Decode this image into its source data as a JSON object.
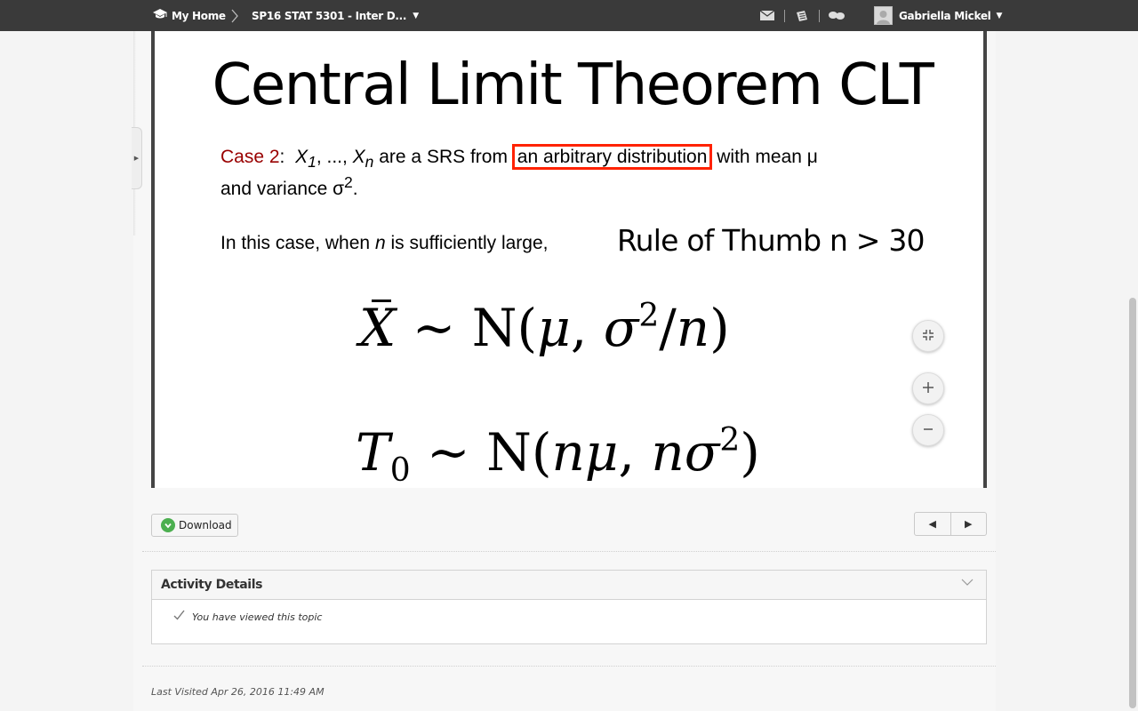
{
  "nav": {
    "home_label": "My Home",
    "course_label": "SP16 STAT 5301 - Inter D...",
    "user_name": "Gabriella Mickel",
    "icons": [
      "mail-icon",
      "updates-icon",
      "chat-icon"
    ]
  },
  "slide": {
    "title": "Central Limit Theorem CLT",
    "case_label": "Case 2",
    "case_colon": ":",
    "x1": "X",
    "sub1": "1",
    "ellipsis": ", ..., ",
    "xn": "X",
    "subn": "n",
    "text_before_highlight": " are a SRS from ",
    "highlight_text": "an arbitrary distribution",
    "text_after_highlight": " with mean μ",
    "line2_prefix": "and variance σ",
    "line2_sup": "2",
    "line2_suffix": ".",
    "n_line_prefix": "In this case, when ",
    "n_var": "n",
    "n_line_suffix": " is sufficiently large,",
    "rule_of_thumb": "Rule of Thumb n > 30",
    "formula1": {
      "lhs": "X",
      "rest_a": " ~ N(",
      "mu": "μ",
      "comma": ", ",
      "sigma": "σ",
      "sup": "2",
      "rest_b": "/",
      "n": "n",
      "close": ")"
    },
    "formula2": {
      "lhs": "T",
      "sub": "0",
      "rest_a": " ~ N(",
      "nmu": "nμ",
      "comma": ", ",
      "nsigma": "nσ",
      "sup": "2",
      "close": ")"
    }
  },
  "controls": {
    "download_label": "Download",
    "prev_glyph": "◀",
    "next_glyph": "▶"
  },
  "activity": {
    "heading": "Activity Details",
    "viewed_text": "You have viewed this topic"
  },
  "footer": {
    "last_visited": "Last Visited Apr 26, 2016 11:49 AM"
  }
}
